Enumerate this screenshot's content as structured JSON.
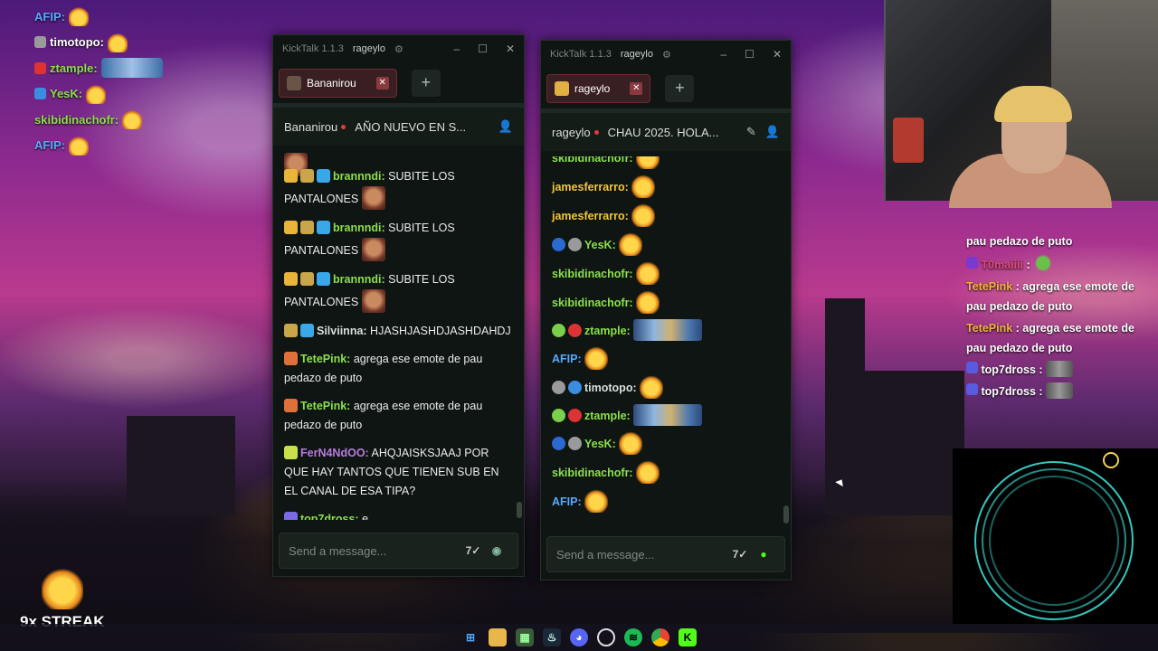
{
  "colors": {
    "accent_green": "#53fc18",
    "username_green": "#8be04a",
    "username_gold": "#f2c53a",
    "username_purple": "#b77be0"
  },
  "overlay_chat": [
    {
      "name": "AFIP:",
      "color": "#5aa8ff"
    },
    {
      "name": "timotopo:",
      "color": "#ffffff"
    },
    {
      "name": "ztample:",
      "color": "#8be04a"
    },
    {
      "name": "YesK:",
      "color": "#8be04a"
    },
    {
      "name": "skibidinachofr:",
      "color": "#8be04a"
    },
    {
      "name": "AFIP:",
      "color": "#5aa8ff"
    }
  ],
  "window1": {
    "app_title": "KickTalk 1.1.3",
    "user": "rageylo",
    "tab_label": "Bananirou",
    "channel": "Bananirou",
    "stream_title": "AÑO NUEVO EN S...",
    "input_placeholder": "Send a message...",
    "messages": [
      {
        "name": "brannndi:",
        "color": "#8be04a",
        "text": "SUBITE LOS PANTALONES"
      },
      {
        "name": "brannndi:",
        "color": "#8be04a",
        "text": "SUBITE LOS PANTALONES"
      },
      {
        "name": "brannndi:",
        "color": "#8be04a",
        "text": "SUBITE LOS PANTALONES"
      },
      {
        "name": "Silviinna:",
        "color": "#d9dfdb",
        "text": "HJASHJASHDJASHDAHDJ"
      },
      {
        "name": "TetePink:",
        "color": "#8be04a",
        "text": "agrega ese emote de pau pedazo de puto"
      },
      {
        "name": "TetePink:",
        "color": "#8be04a",
        "text": "agrega ese emote de pau pedazo de puto"
      },
      {
        "name": "FerN4NdOO:",
        "color": "#b77be0",
        "text": "AHQJAISKSJAAJ POR QUE HAY TANTOS QUE TIENEN SUB EN EL CANAL DE ESA TIPA?"
      },
      {
        "name": "top7dross:",
        "color": "#8be04a",
        "text": "e"
      }
    ]
  },
  "window2": {
    "app_title": "KickTalk 1.1.3",
    "user": "rageylo",
    "tab_label": "rageylo",
    "channel": "rageylo",
    "stream_title": "CHAU 2025. HOLA...",
    "input_placeholder": "Send a message...",
    "messages": [
      {
        "name": "skibidinachofr:",
        "color": "#8be04a",
        "emote": "pe"
      },
      {
        "name": "jamesferrarro:",
        "color": "#f2c53a",
        "emote": "pe"
      },
      {
        "name": "jamesferrarro:",
        "color": "#f2c53a",
        "emote": "pe"
      },
      {
        "name": "YesK:",
        "color": "#8be04a",
        "emote": "pe"
      },
      {
        "name": "skibidinachofr:",
        "color": "#8be04a",
        "emote": "pe"
      },
      {
        "name": "skibidinachofr:",
        "color": "#8be04a",
        "emote": "pe"
      },
      {
        "name": "ztample:",
        "color": "#8be04a",
        "emote": "we"
      },
      {
        "name": "AFIP:",
        "color": "#5aa8ff",
        "emote": "pe"
      },
      {
        "name": "timotopo:",
        "color": "#d9dfdb",
        "emote": "pe"
      },
      {
        "name": "ztample:",
        "color": "#8be04a",
        "emote": "we"
      },
      {
        "name": "YesK:",
        "color": "#8be04a",
        "emote": "pe"
      },
      {
        "name": "skibidinachofr:",
        "color": "#8be04a",
        "emote": "pe"
      },
      {
        "name": "AFIP:",
        "color": "#5aa8ff",
        "emote": "pe"
      }
    ]
  },
  "right_chat": [
    {
      "html": "pau pedazo de puto",
      "cls": "tp"
    },
    {
      "name": "T0maiiii",
      "colon": ":",
      "emote": true
    },
    {
      "name": "TetePink",
      "text": " : agrega ese emote de pau pedazo de puto"
    },
    {
      "name": "TetePink",
      "text": " : agrega ese emote de pau pedazo de puto"
    },
    {
      "name": "top7dross",
      "text": " :",
      "mini": true
    },
    {
      "name": "top7dross",
      "text": " :",
      "mini": true
    }
  ],
  "streak": "9x STREAK"
}
